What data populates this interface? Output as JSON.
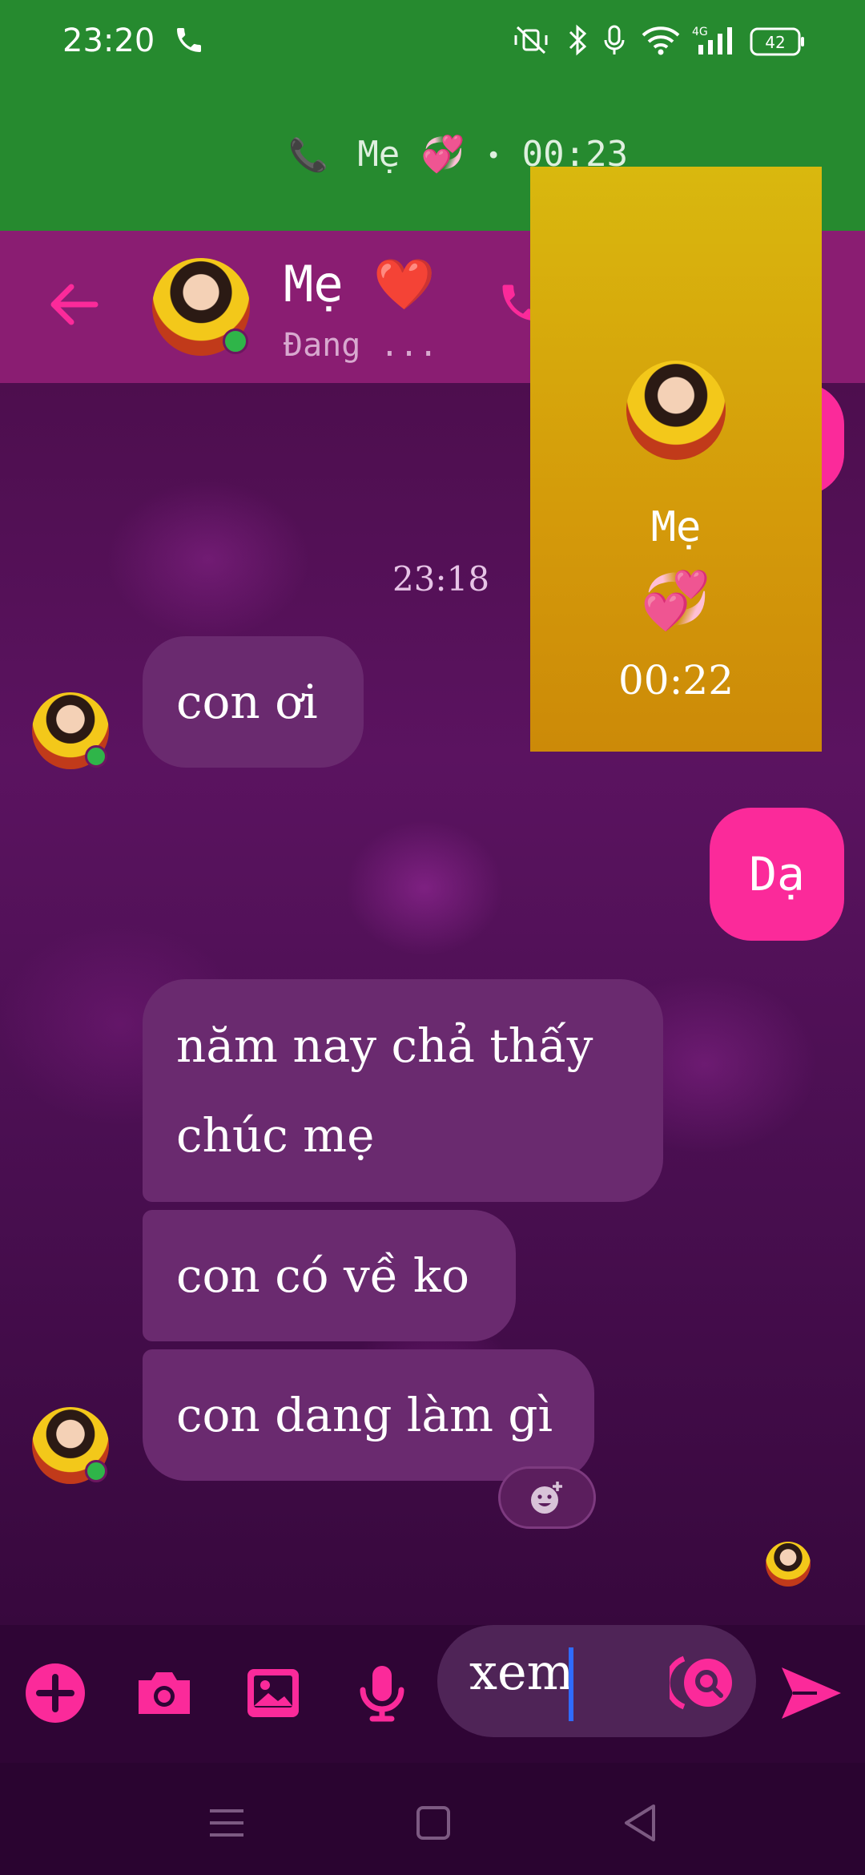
{
  "status_bar": {
    "time": "23:20",
    "battery": "42"
  },
  "call_banner": {
    "name": "Mẹ 💞",
    "separator": "•",
    "duration": "00:23"
  },
  "chat_header": {
    "name": "Mẹ ❤️",
    "status": "Đang ...",
    "accent_color": "#fb2a9a"
  },
  "messages": {
    "timestamp": "23:18",
    "items": [
      {
        "sender": "them",
        "text": "con ơi"
      },
      {
        "sender": "me",
        "text": "Dạ"
      },
      {
        "sender": "them",
        "text_line1": "năm nay chả thấy",
        "text_line2": "chúc mẹ"
      },
      {
        "sender": "them",
        "text": "con có về ko"
      },
      {
        "sender": "them",
        "text": "con dang làm gì"
      }
    ]
  },
  "composer": {
    "input_value": "xem"
  },
  "call_window": {
    "name": "Mẹ",
    "emoji": "💞",
    "duration": "00:22"
  }
}
